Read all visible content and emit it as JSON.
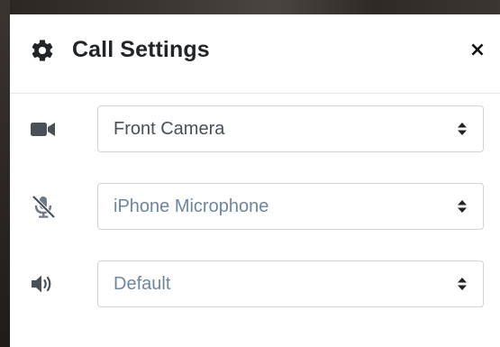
{
  "modal": {
    "title": "Call Settings",
    "close_label": "×",
    "icons": {
      "header": "gear-icon",
      "close": "close-icon"
    }
  },
  "settings": [
    {
      "icon": "video-camera-icon",
      "selected": "Front Camera",
      "muted": false
    },
    {
      "icon": "microphone-muted-icon",
      "selected": "iPhone Microphone",
      "muted": true
    },
    {
      "icon": "speaker-icon",
      "selected": "Default",
      "muted": true
    }
  ],
  "colors": {
    "title": "#212529",
    "icon": "#495057",
    "select_text": "#495057",
    "select_text_muted": "#6c86a0",
    "border": "#ced4da",
    "divider": "#e3e6ea"
  }
}
